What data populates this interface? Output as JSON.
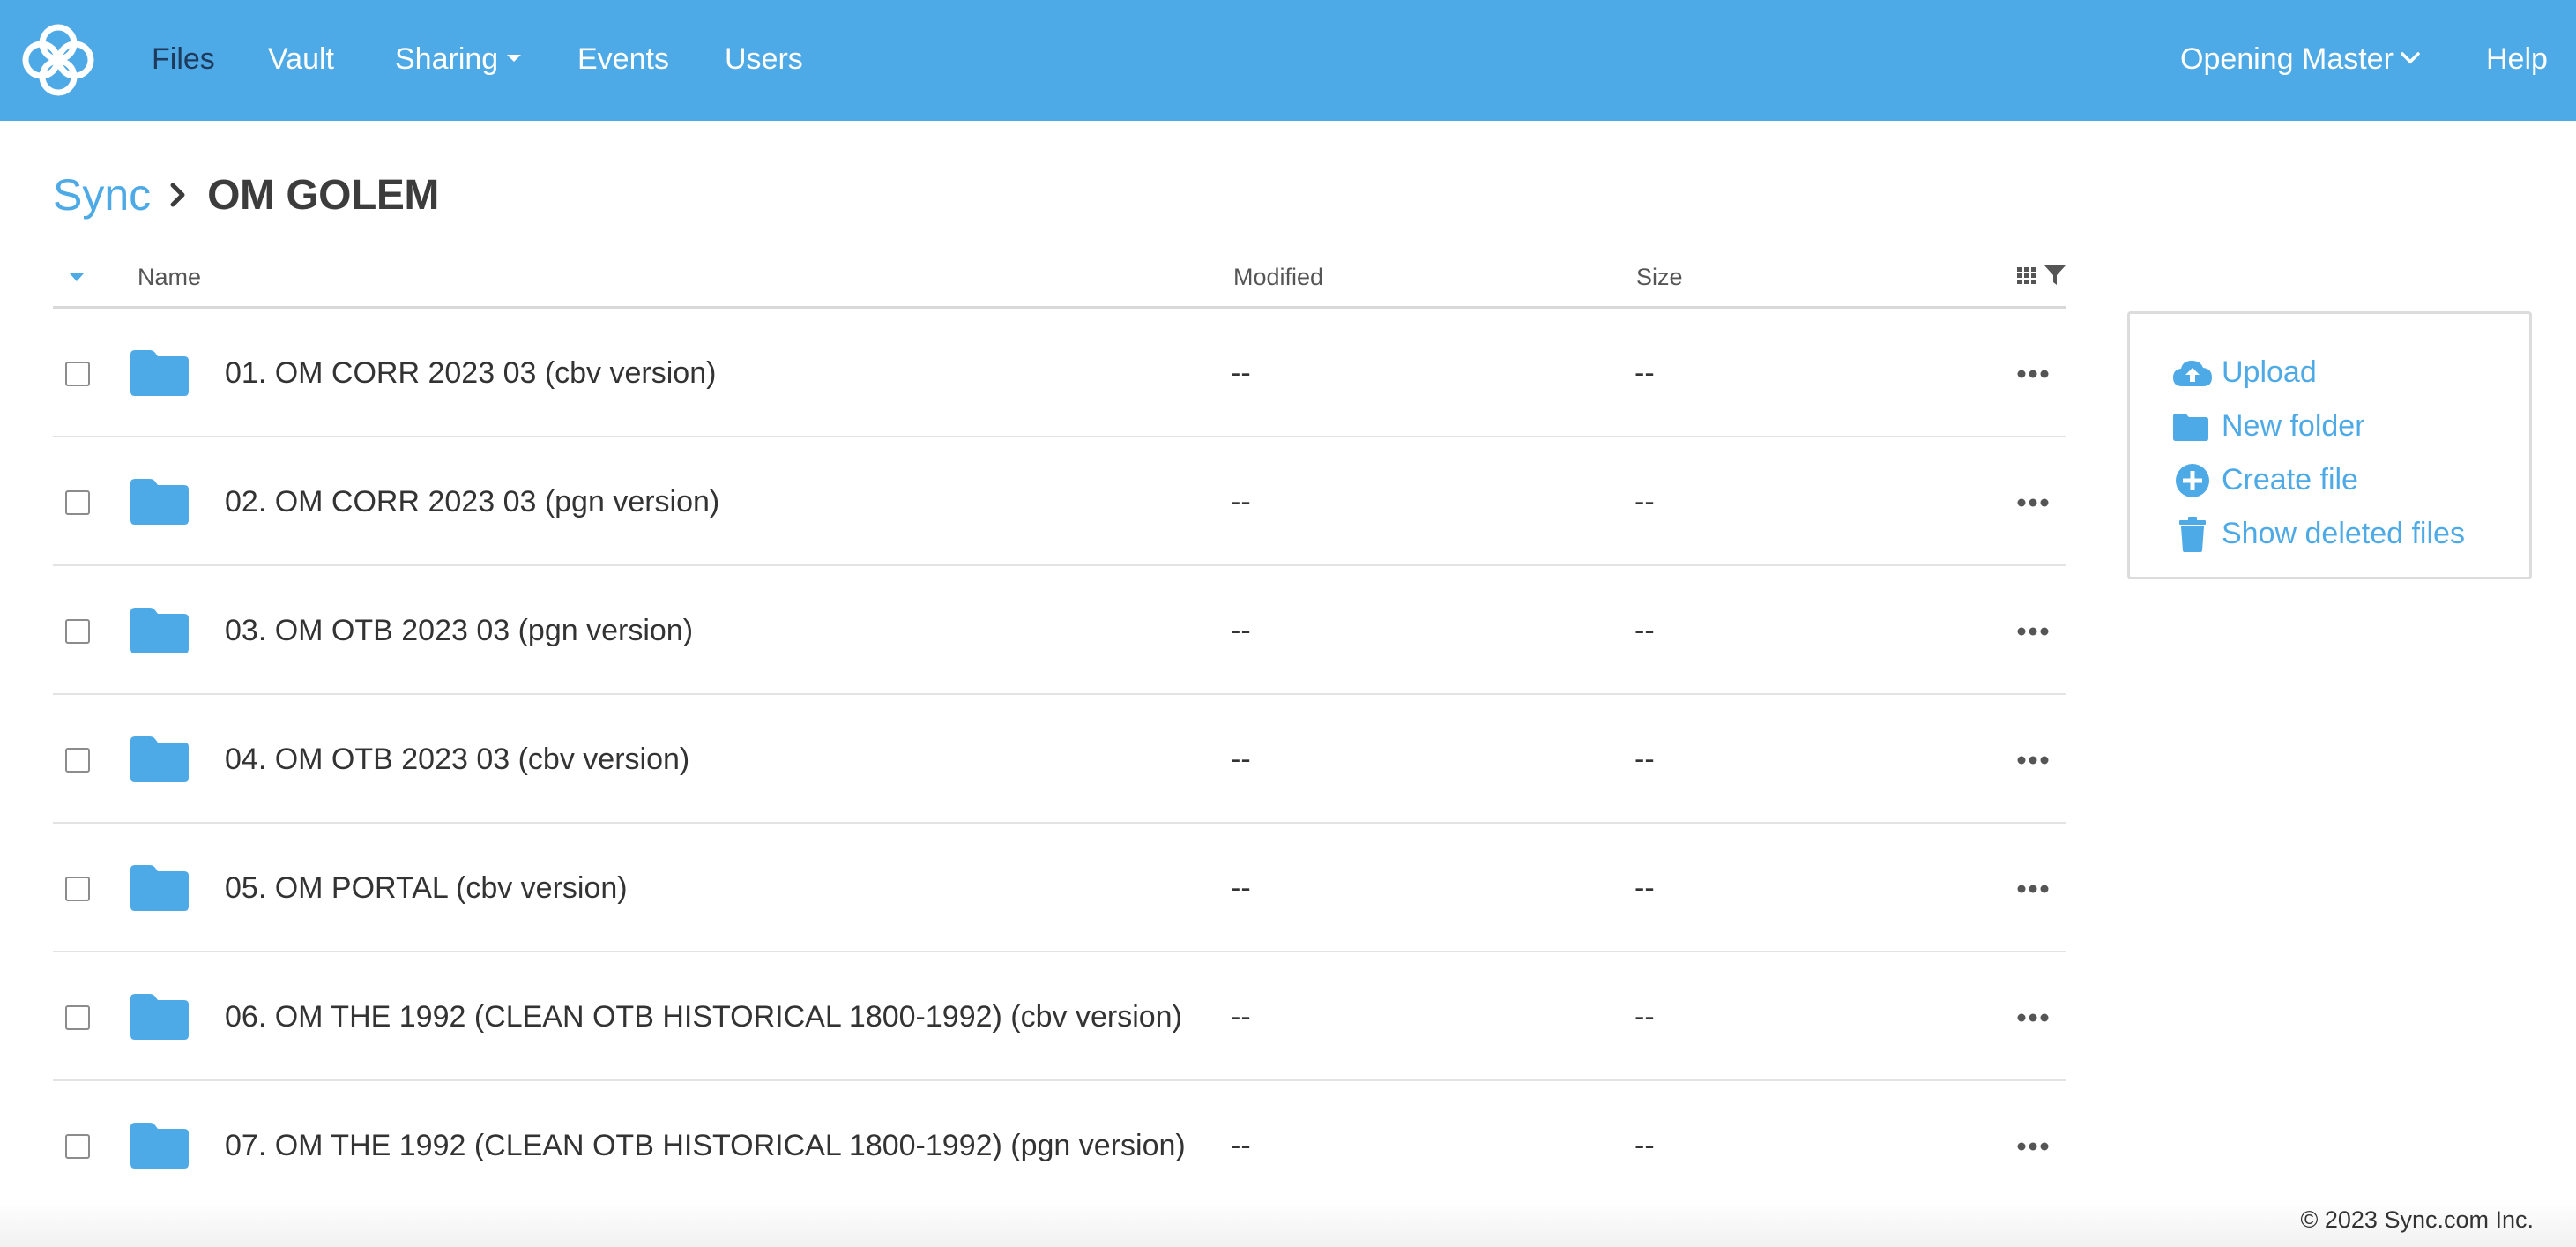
{
  "nav": {
    "items": [
      {
        "label": "Files",
        "active": true
      },
      {
        "label": "Vault"
      },
      {
        "label": "Sharing"
      },
      {
        "label": "Events"
      },
      {
        "label": "Users"
      }
    ],
    "account": "Opening Master",
    "help": "Help"
  },
  "breadcrumb": {
    "root": "Sync",
    "current": "OM GOLEM"
  },
  "table": {
    "columns": {
      "name": "Name",
      "modified": "Modified",
      "size": "Size"
    },
    "rows": [
      {
        "name": "01. OM CORR 2023 03 (cbv version)",
        "modified": "--",
        "size": "--"
      },
      {
        "name": "02. OM CORR 2023 03 (pgn version)",
        "modified": "--",
        "size": "--"
      },
      {
        "name": "03. OM OTB 2023 03 (pgn version)",
        "modified": "--",
        "size": "--"
      },
      {
        "name": "04. OM OTB 2023 03 (cbv version)",
        "modified": "--",
        "size": "--"
      },
      {
        "name": "05. OM PORTAL (cbv version)",
        "modified": "--",
        "size": "--"
      },
      {
        "name": "06. OM THE 1992 (CLEAN OTB HISTORICAL 1800-1992) (cbv version)",
        "modified": "--",
        "size": "--"
      },
      {
        "name": "07. OM THE 1992 (CLEAN OTB HISTORICAL 1800-1992) (pgn version)",
        "modified": "--",
        "size": "--"
      }
    ]
  },
  "actions": {
    "upload": "Upload",
    "new_folder": "New folder",
    "create_file": "Create file",
    "show_deleted": "Show deleted files"
  },
  "footer": {
    "copyright": "© 2023 Sync.com Inc."
  },
  "colors": {
    "brand": "#4eaae6",
    "nav_active": "#1e3a5c",
    "folder": "#4eaae6"
  }
}
